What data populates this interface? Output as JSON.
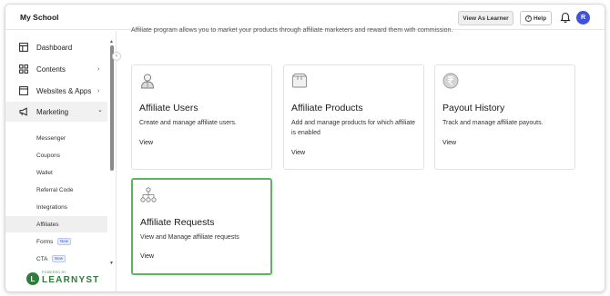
{
  "header": {
    "school_name": "My School",
    "view_as_learner": "View As Learner",
    "help": "Help",
    "avatar_initial": "R"
  },
  "sidebar": {
    "main_items": [
      {
        "label": "Dashboard",
        "icon": "dashboard-icon"
      },
      {
        "label": "Contents",
        "icon": "grid-icon",
        "chevron": "›"
      },
      {
        "label": "Websites & Apps",
        "icon": "browser-icon",
        "chevron": "›"
      },
      {
        "label": "Marketing",
        "icon": "megaphone-icon",
        "chevron": "⌄"
      }
    ],
    "sub_items": [
      {
        "label": "Messenger"
      },
      {
        "label": "Coupons"
      },
      {
        "label": "Wallet"
      },
      {
        "label": "Referral Code"
      },
      {
        "label": "Integrations"
      },
      {
        "label": "Affiliates"
      },
      {
        "label": "Forms",
        "badge": "New"
      },
      {
        "label": "CTA",
        "badge": "New"
      }
    ],
    "powered_by": "POWERED BY",
    "brand_word": "LEARNYST"
  },
  "main": {
    "intro_text": "Affiliate program allows you to market your products through affiliate marketers and reward them with commission.",
    "cards": [
      {
        "title": "Affiliate Users",
        "description": "Create and manage affiliate users.",
        "view": "View",
        "icon": "affiliate-user-icon"
      },
      {
        "title": "Affiliate Products",
        "description": "Add and manage products for which affiliate is enabled",
        "view": "View",
        "icon": "product-box-icon"
      },
      {
        "title": "Payout History",
        "description": "Track and manage affiliate payouts.",
        "view": "View",
        "icon": "rupee-coin-icon"
      },
      {
        "title": "Affiliate Requests",
        "description": "View and Manage affiliate requests",
        "view": "View",
        "icon": "network-icon"
      }
    ]
  },
  "colors": {
    "accent_blue": "#3f51e0",
    "highlight_green": "#5bb75b",
    "brand_green": "#2e7d3a"
  }
}
